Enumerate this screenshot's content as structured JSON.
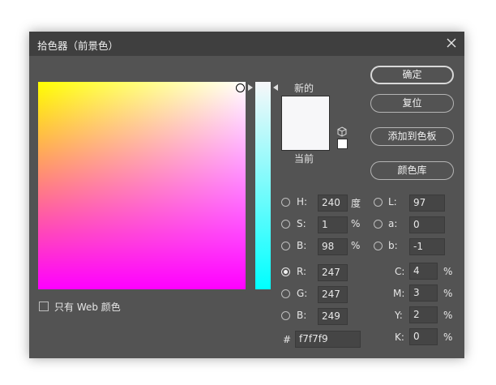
{
  "window": {
    "title": "拾色器（前景色）"
  },
  "preview": {
    "new_label": "新的",
    "current_label": "当前",
    "new_color": "#f7f7f9",
    "current_color": "#f7f7f9"
  },
  "buttons": {
    "ok": "确定",
    "reset": "复位",
    "add_to_swatches": "添加到色板",
    "color_libraries": "颜色库"
  },
  "only_web_colors": {
    "label": "只有 Web 颜色",
    "checked": false
  },
  "hsb": {
    "h": {
      "label": "H:",
      "value": "240",
      "unit": "度"
    },
    "s": {
      "label": "S:",
      "value": "1",
      "unit": "%"
    },
    "b": {
      "label": "B:",
      "value": "98",
      "unit": "%"
    }
  },
  "rgb": {
    "r": {
      "label": "R:",
      "value": "247"
    },
    "g": {
      "label": "G:",
      "value": "247"
    },
    "b": {
      "label": "B:",
      "value": "249"
    }
  },
  "lab": {
    "l": {
      "label": "L:",
      "value": "97"
    },
    "a": {
      "label": "a:",
      "value": "0"
    },
    "b": {
      "label": "b:",
      "value": "-1"
    }
  },
  "cmyk": {
    "c": {
      "label": "C:",
      "value": "4",
      "unit": "%"
    },
    "m": {
      "label": "M:",
      "value": "3",
      "unit": "%"
    },
    "y": {
      "label": "Y:",
      "value": "2",
      "unit": "%"
    },
    "k": {
      "label": "K:",
      "value": "0",
      "unit": "%"
    }
  },
  "hex": {
    "label": "#",
    "value": "f7f7f9"
  },
  "selected_channel": "R",
  "colors": {
    "dialog_bg": "#535353",
    "titlebar_bg": "#3f3f3f",
    "input_bg": "#454545"
  }
}
